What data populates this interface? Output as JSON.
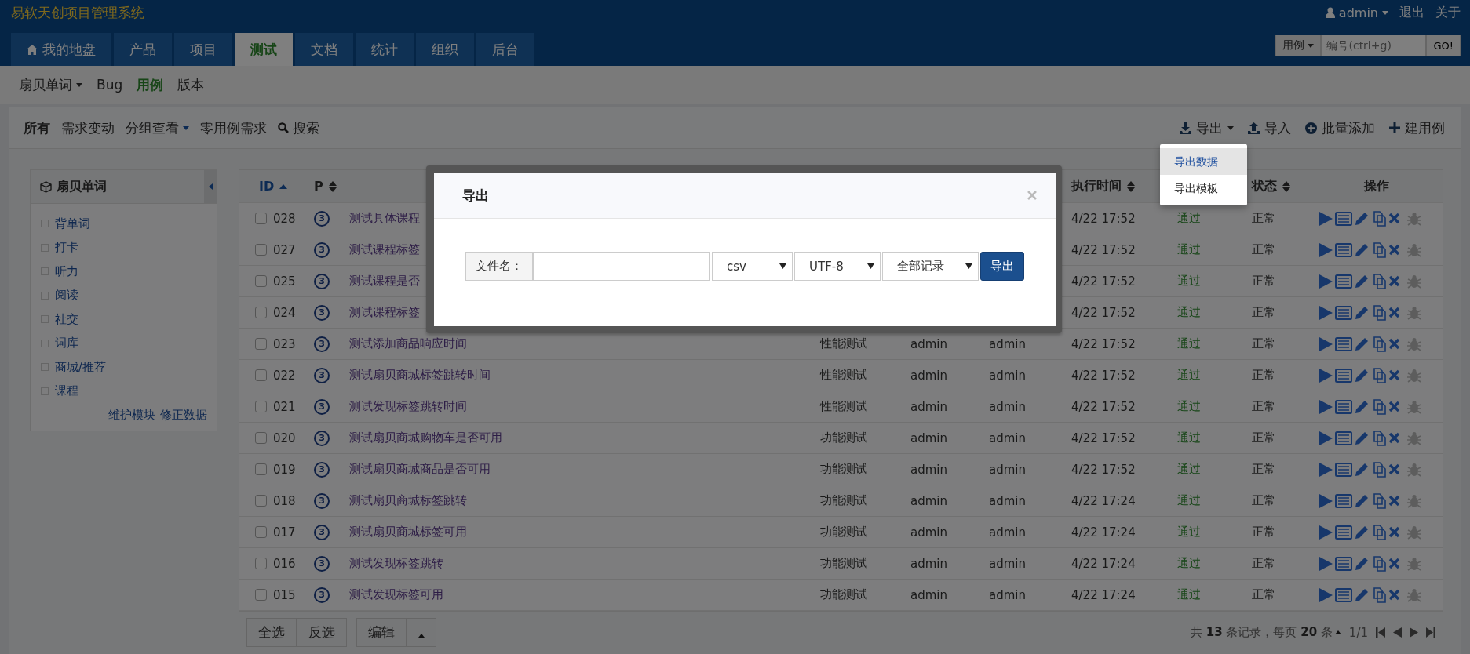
{
  "app_title": "易软天创项目管理系统",
  "user_menu": {
    "user": "admin",
    "links": [
      "退出",
      "关于"
    ]
  },
  "main_nav": [
    {
      "label": "我的地盘",
      "kind": "home",
      "selected": false
    },
    {
      "label": "产品",
      "selected": false
    },
    {
      "label": "项目",
      "selected": false
    },
    {
      "label": "测试",
      "selected": true
    },
    {
      "label": "文档",
      "selected": false
    },
    {
      "label": "统计",
      "selected": false
    },
    {
      "label": "组织",
      "selected": false
    },
    {
      "label": "后台",
      "selected": false
    }
  ],
  "quick_search": {
    "type": "用例",
    "placeholder": "编号(ctrl+g)",
    "button": "GO!"
  },
  "sub_nav": [
    {
      "label": "扇贝单词",
      "kind": "dropdown",
      "selected": false
    },
    {
      "label": "Bug",
      "selected": false
    },
    {
      "label": "用例",
      "selected": true
    },
    {
      "label": "版本",
      "selected": false
    }
  ],
  "toolbar": {
    "filters": [
      {
        "label": "所有",
        "selected": true
      },
      {
        "label": "需求变动",
        "selected": false
      },
      {
        "label": "分组查看",
        "kind": "dropdown",
        "selected": false
      },
      {
        "label": "零用例需求",
        "selected": false
      },
      {
        "label": "搜索",
        "kind": "search",
        "selected": false
      }
    ],
    "actions": [
      {
        "label": "导出",
        "kind": "export"
      },
      {
        "label": "导入",
        "kind": "import"
      },
      {
        "label": "批量添加",
        "kind": "batch"
      },
      {
        "label": "建用例",
        "kind": "create"
      }
    ]
  },
  "export_menu": [
    {
      "label": "导出数据",
      "selected": true
    },
    {
      "label": "导出模板",
      "selected": false
    }
  ],
  "sidebar": {
    "title": "扇贝单词",
    "items": [
      "背单词",
      "打卡",
      "听力",
      "阅读",
      "社交",
      "词库",
      "商城/推荐",
      "课程"
    ],
    "links": [
      "维护模块",
      "修正数据"
    ]
  },
  "table": {
    "header": {
      "id": {
        "label": "ID",
        "sorted": true
      },
      "priority": {
        "label": "P",
        "sorted": false
      },
      "run_time": {
        "label": "执行时间",
        "sorted": false
      },
      "status": {
        "label": "状态",
        "sorted": false
      },
      "actions": {
        "label": "操作"
      }
    },
    "rows": [
      {
        "checked": false,
        "id": "028",
        "priority": "3",
        "title": "测试具体课程",
        "run_time": "4/22 17:52",
        "result": "通过",
        "status": "正常"
      },
      {
        "checked": false,
        "id": "027",
        "priority": "3",
        "title": "测试课程标签",
        "run_time": "4/22 17:52",
        "result": "通过",
        "status": "正常"
      },
      {
        "checked": false,
        "id": "025",
        "priority": "3",
        "title": "测试课程是否",
        "run_time": "4/22 17:52",
        "result": "通过",
        "status": "正常"
      },
      {
        "checked": false,
        "id": "024",
        "priority": "3",
        "title": "测试课程标签",
        "run_time": "4/22 17:52",
        "result": "通过",
        "status": "正常"
      },
      {
        "checked": false,
        "id": "023",
        "priority": "3",
        "title": "测试添加商品响应时间",
        "type": "性能测试",
        "creator": "admin",
        "executor": "admin",
        "run_time": "4/22 17:52",
        "result": "通过",
        "status": "正常"
      },
      {
        "checked": false,
        "id": "022",
        "priority": "3",
        "title": "测试扇贝商城标签跳转时间",
        "type": "性能测试",
        "creator": "admin",
        "executor": "admin",
        "run_time": "4/22 17:52",
        "result": "通过",
        "status": "正常"
      },
      {
        "checked": false,
        "id": "021",
        "priority": "3",
        "title": "测试发现标签跳转时间",
        "type": "性能测试",
        "creator": "admin",
        "executor": "admin",
        "run_time": "4/22 17:52",
        "result": "通过",
        "status": "正常"
      },
      {
        "checked": false,
        "id": "020",
        "priority": "3",
        "title": "测试扇贝商城购物车是否可用",
        "type": "功能测试",
        "creator": "admin",
        "executor": "admin",
        "run_time": "4/22 17:52",
        "result": "通过",
        "status": "正常"
      },
      {
        "checked": false,
        "id": "019",
        "priority": "3",
        "title": "测试扇贝商城商品是否可用",
        "type": "功能测试",
        "creator": "admin",
        "executor": "admin",
        "run_time": "4/22 17:52",
        "result": "通过",
        "status": "正常"
      },
      {
        "checked": false,
        "id": "018",
        "priority": "3",
        "title": "测试扇贝商城标签跳转",
        "type": "功能测试",
        "creator": "admin",
        "executor": "admin",
        "run_time": "4/22 17:24",
        "result": "通过",
        "status": "正常"
      },
      {
        "checked": false,
        "id": "017",
        "priority": "3",
        "title": "测试扇贝商城标签可用",
        "type": "功能测试",
        "creator": "admin",
        "executor": "admin",
        "run_time": "4/22 17:24",
        "result": "通过",
        "status": "正常"
      },
      {
        "checked": false,
        "id": "016",
        "priority": "3",
        "title": "测试发现标签跳转",
        "type": "功能测试",
        "creator": "admin",
        "executor": "admin",
        "run_time": "4/22 17:24",
        "result": "通过",
        "status": "正常"
      },
      {
        "checked": false,
        "id": "015",
        "priority": "3",
        "title": "测试发现标签可用",
        "type": "功能测试",
        "creator": "admin",
        "executor": "admin",
        "run_time": "4/22 17:24",
        "result": "通过",
        "status": "正常"
      }
    ]
  },
  "footer": {
    "buttons": [
      "全选",
      "反选"
    ],
    "edit": "编辑",
    "summary": "共 **13** 条记录，每页 **20** 条",
    "page": "1/1"
  },
  "modal": {
    "title": "导出",
    "filename_label": "文件名：",
    "format": "csv",
    "encoding": "UTF-8",
    "range": "全部记录",
    "submit": "导出"
  }
}
